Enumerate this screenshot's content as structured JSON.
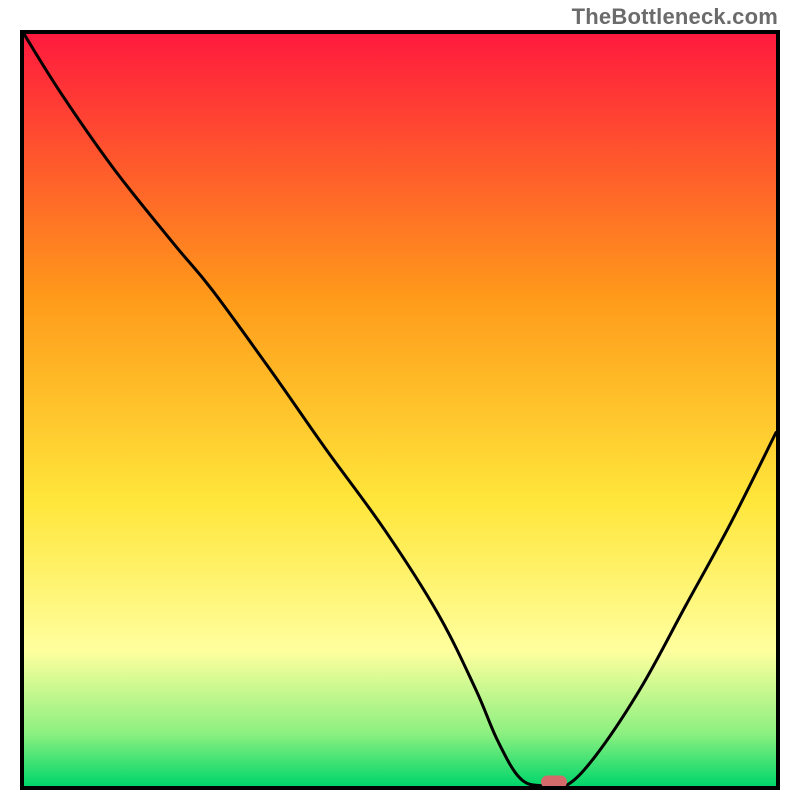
{
  "watermark": "TheBottleneck.com",
  "colors": {
    "red": "#ff1a3e",
    "orange": "#ff9a1a",
    "yellow": "#ffe63a",
    "paleyellow": "#ffff9e",
    "lightgreen": "#8cf080",
    "green": "#00d66a",
    "frame": "#000000",
    "curve": "#000000",
    "marker": "#d46a6a"
  },
  "chart_data": {
    "type": "line",
    "title": "",
    "xlabel": "",
    "ylabel": "",
    "xlim": [
      0,
      100
    ],
    "ylim": [
      0,
      100
    ],
    "series": [
      {
        "name": "bottleneck-curve",
        "x": [
          0,
          5,
          12,
          20,
          25,
          33,
          40,
          48,
          55,
          60,
          63,
          66,
          69,
          72,
          76,
          82,
          88,
          94,
          100
        ],
        "values": [
          100,
          92,
          82,
          72,
          66,
          55,
          45,
          34,
          23,
          13,
          6,
          1,
          0,
          0,
          4,
          13,
          24,
          35,
          47
        ]
      }
    ],
    "annotations": [
      {
        "name": "optimal-marker",
        "x": 70.5,
        "y": 0
      }
    ],
    "gradient_stops_pct": [
      {
        "p": 0,
        "c": "red"
      },
      {
        "p": 35,
        "c": "orange"
      },
      {
        "p": 62,
        "c": "yellow"
      },
      {
        "p": 82,
        "c": "paleyellow"
      },
      {
        "p": 93,
        "c": "lightgreen"
      },
      {
        "p": 100,
        "c": "green"
      }
    ]
  }
}
